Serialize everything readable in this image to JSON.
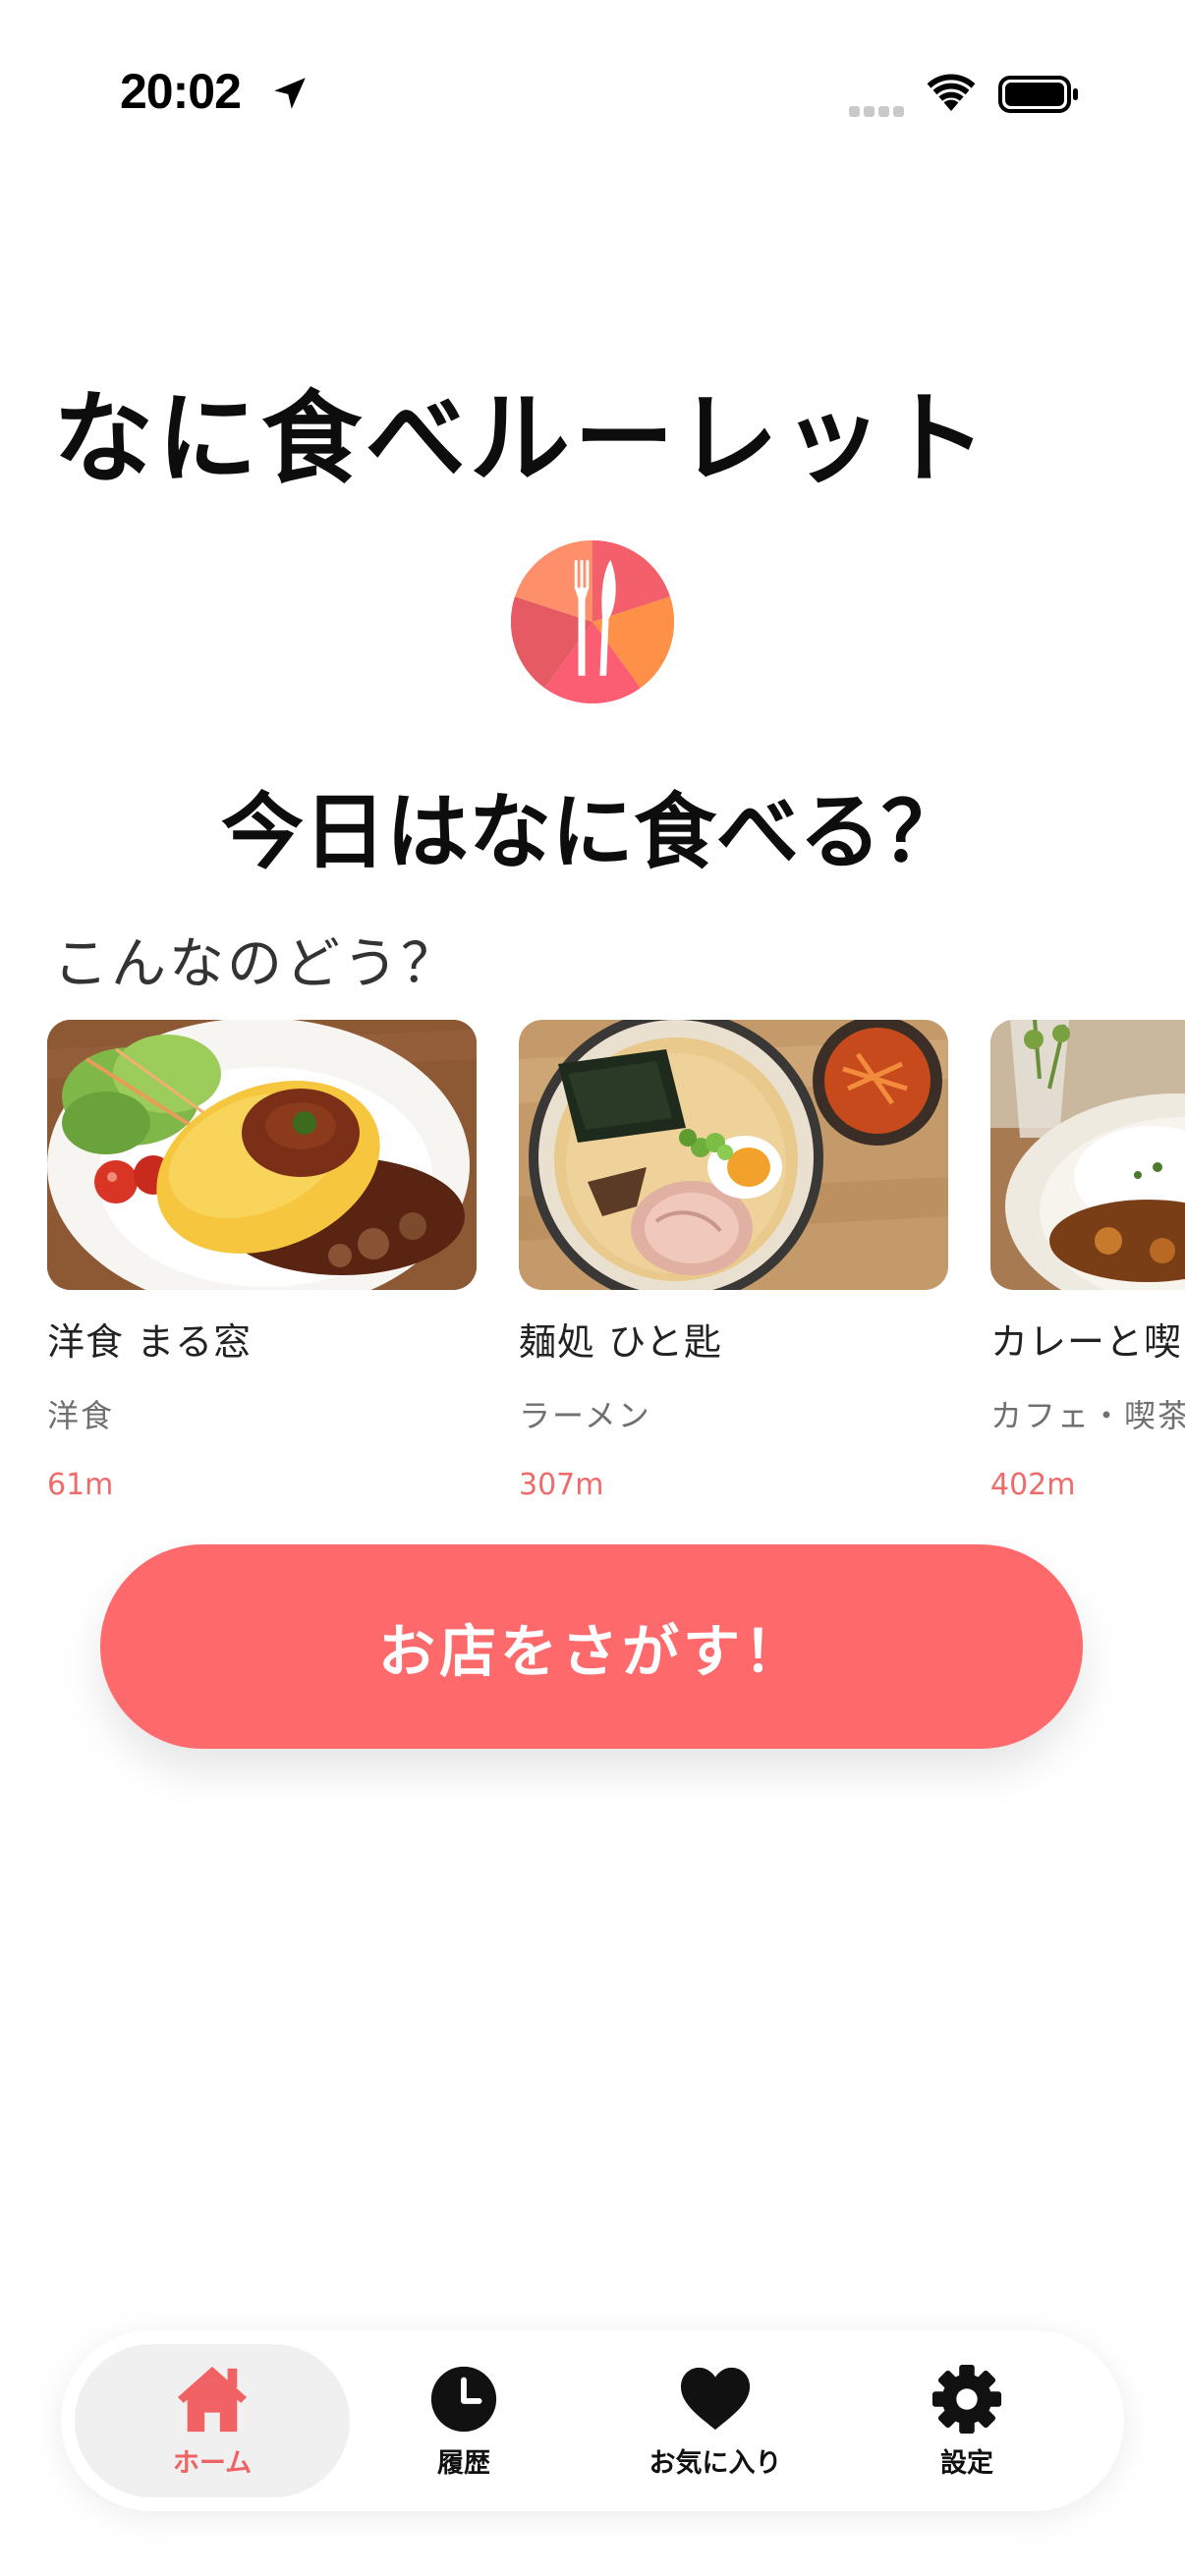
{
  "colors": {
    "accent": "#fe6a6c",
    "distance_text": "#ee6b6b",
    "active_tab_bg": "#f0f0f0",
    "logo_segments": [
      "#fd8f6b",
      "#f35f6b",
      "#e55a63",
      "#ff9048",
      "#fb5d72"
    ]
  },
  "status_bar": {
    "time": "20:02",
    "icons": [
      "location-arrow-icon",
      "cellular-signal-icon",
      "wifi-icon",
      "battery-icon"
    ]
  },
  "app_title": "なに食べルーレット",
  "logo_icon": "fork-knife-roulette-icon",
  "question": "今日はなに食べる？",
  "section_label": "こんなのどう？",
  "recommendations": [
    {
      "name": "洋食 まる窓",
      "genre": "洋食",
      "distance": "61m",
      "photo": "omurice-photo"
    },
    {
      "name": "麺処 ひと匙",
      "genre": "ラーメン",
      "distance": "307m",
      "photo": "ramen-photo"
    },
    {
      "name": "カレーと喫",
      "genre": "カフェ・喫茶",
      "distance": "402m",
      "photo": "curry-photo"
    }
  ],
  "search_button": "お店をさがす！",
  "tabs": [
    {
      "label": "ホーム",
      "icon": "home-icon",
      "active": true
    },
    {
      "label": "履歴",
      "icon": "clock-icon",
      "active": false
    },
    {
      "label": "お気に入り",
      "icon": "heart-icon",
      "active": false
    },
    {
      "label": "設定",
      "icon": "gear-icon",
      "active": false
    }
  ]
}
